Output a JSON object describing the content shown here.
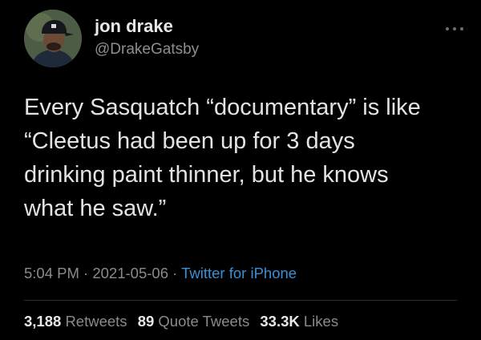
{
  "author": {
    "display_name": "jon drake",
    "handle": "@DrakeGatsby",
    "avatar_icon": "avatar-icon"
  },
  "tweet": {
    "lines": [
      "Every Sasquatch “documentary” is like",
      "“Cleetus had been up for 3 days",
      "drinking paint thinner, but he knows",
      "what he saw.”"
    ]
  },
  "meta": {
    "time": "5:04 PM",
    "separator": " · ",
    "date": "2021-05-06",
    "source": "Twitter for iPhone"
  },
  "stats": {
    "retweets_count": "3,188",
    "retweets_label": "Retweets",
    "quotes_count": "89",
    "quotes_label": "Quote Tweets",
    "likes_count": "33.3K",
    "likes_label": "Likes"
  },
  "colors": {
    "background": "#000000",
    "link": "#3a8fd6",
    "muted": "#8a8a8a"
  }
}
